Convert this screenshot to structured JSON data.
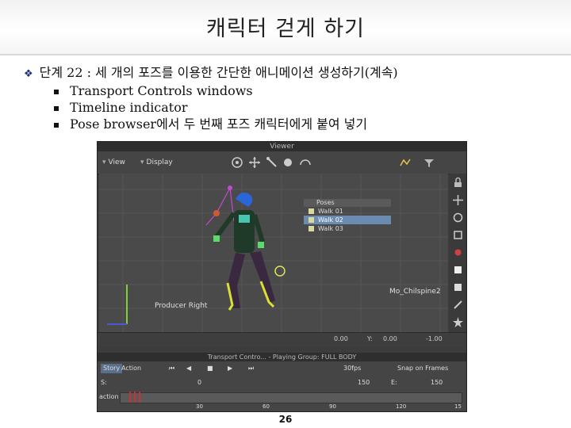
{
  "slide": {
    "title": "캐릭터 걷게 하기",
    "bullet": "단계 22 : 세 개의 포즈를 이용한 간단한 애니메이션 생성하기(계속)",
    "subbullets": [
      "Transport Controls windows",
      "Timeline indicator",
      "Pose browser에서 두 번째 포즈 캐릭터에게 붙여 넣기"
    ],
    "page_number": "26"
  },
  "app": {
    "viewer_title": "Viewer",
    "menu": {
      "view": "View",
      "display": "Display"
    },
    "camera_label": "Producer Right",
    "character_label": "Mo_Chilspine2",
    "pose_browser": {
      "title": "Poses",
      "items": [
        "Walk 01",
        "Walk 02",
        "Walk 03"
      ],
      "selected": 1
    },
    "coords": {
      "x": "0.00",
      "y_label": "Y:",
      "y": "0.00",
      "z": "-1.00"
    },
    "transport": {
      "title": "Transport Contro... - Playing Group: FULL BODY",
      "story": "Story",
      "action": "Action",
      "fps": "30fps",
      "snap": "Snap on Frames",
      "start_label": "S:",
      "start": "0",
      "end_label": "E:",
      "end": "150",
      "frame_field": "0",
      "frame_value": "150",
      "action_label": "action",
      "ruler": [
        "30",
        "60",
        "90",
        "120",
        "15"
      ]
    },
    "colors": {
      "accent": "#6b8bb0",
      "frame_marker": "#c83232"
    }
  }
}
